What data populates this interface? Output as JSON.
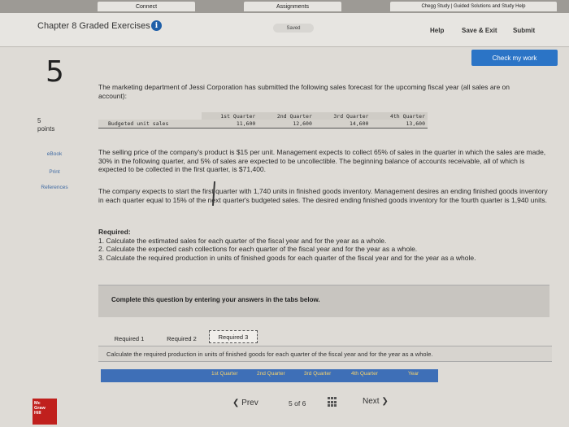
{
  "browser": {
    "tabs": [
      "Connect",
      "Assignments",
      "Chegg Study | Guided Solutions and Study Help"
    ]
  },
  "header": {
    "title": "Chapter 8 Graded Exercises",
    "saved": "Saved",
    "help": "Help",
    "save_exit": "Save & Exit",
    "submit": "Submit"
  },
  "question": {
    "number": "5",
    "points_value": "5",
    "points_label": "points",
    "check_my_work": "Check my work",
    "side_links": [
      "eBook",
      "Print",
      "References"
    ],
    "intro": "The marketing department of Jessi Corporation has submitted the following sales forecast for the upcoming fiscal year (all sales are on account):",
    "table": {
      "headers": [
        "1st Quarter",
        "2nd Quarter",
        "3rd Quarter",
        "4th Quarter"
      ],
      "row_label": "Budgeted unit sales",
      "values": [
        "11,600",
        "12,600",
        "14,600",
        "13,600"
      ]
    },
    "para2": "The selling price of the company's product is $15 per unit. Management expects to collect 65% of sales in the quarter in which the sales are made, 30% in the following quarter, and 5% of sales are expected to be uncollectible. The beginning balance of accounts receivable, all of which is expected to be collected in the first quarter, is $71,400.",
    "para3": "The company expects to start the first quarter with 1,740 units in finished goods inventory. Management desires an ending finished goods inventory in each quarter equal to 15% of the next quarter's budgeted sales. The desired ending finished goods inventory for the fourth quarter is 1,940 units.",
    "required_title": "Required:",
    "required_items": [
      "1. Calculate the estimated sales for each quarter of the fiscal year and for the year as a whole.",
      "2. Calculate the expected cash collections for each quarter of the fiscal year and for the year as a whole.",
      "3. Calculate the required production in units of finished goods for each quarter of the fiscal year and for the year as a whole."
    ]
  },
  "answer_area": {
    "complete_text": "Complete this question by entering your answers in the tabs below.",
    "tabs": [
      "Required 1",
      "Required 2",
      "Required 3"
    ],
    "active_tab": "Required 3",
    "instruction": "Calculate the required production in units of finished goods for each quarter of the fiscal year and for the year as a whole.",
    "columns": [
      "1st Quarter",
      "2nd Quarter",
      "3rd Quarter",
      "4th Quarter",
      "Year"
    ]
  },
  "footer": {
    "prev": "Prev",
    "page_current": "5",
    "page_of": "of",
    "page_total": "6",
    "next": "Next",
    "logo_lines": [
      "Mc",
      "Graw",
      "Hill"
    ]
  },
  "colors": {
    "accent_blue": "#2b74c6",
    "column_header_text": "#f7d36c",
    "logo_red": "#c0201d"
  }
}
